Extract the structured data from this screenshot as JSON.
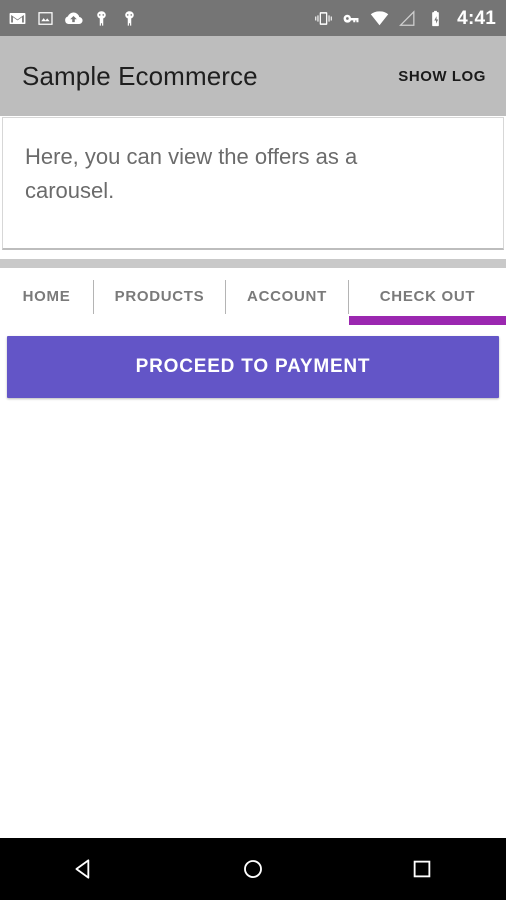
{
  "status_bar": {
    "background": "#757575",
    "clock": "4:41",
    "left_icons": [
      {
        "name": "gmail-icon",
        "label": "Gmail"
      },
      {
        "name": "image-icon",
        "label": "Photos"
      },
      {
        "name": "cloud-upload-icon",
        "label": "Cloud upload"
      },
      {
        "name": "android-debug-icon",
        "label": "Android"
      },
      {
        "name": "android-debug-icon-2",
        "label": "Android"
      }
    ],
    "right_icons": [
      {
        "name": "vibrate-icon",
        "label": "Vibrate"
      },
      {
        "name": "vpn-key-icon",
        "label": "VPN key"
      },
      {
        "name": "wifi-icon",
        "label": "Wi-Fi"
      },
      {
        "name": "signal-icon",
        "label": "No signal"
      },
      {
        "name": "battery-charging-icon",
        "label": "Battery charging"
      }
    ]
  },
  "app_bar": {
    "background": "#bdbdbd",
    "title": "Sample Ecommerce",
    "action_label": "SHOW LOG"
  },
  "card": {
    "text": "Here, you can view the offers as a carousel."
  },
  "tabs": {
    "selected_index": 3,
    "indicator_color": "#9b27b0",
    "items": [
      {
        "label": "HOME",
        "name": "tab-home"
      },
      {
        "label": "PRODUCTS",
        "name": "tab-products"
      },
      {
        "label": "ACCOUNT",
        "name": "tab-account"
      },
      {
        "label": "CHECK OUT",
        "name": "tab-checkout"
      }
    ]
  },
  "content": {
    "primary_button_label": "PROCEED TO PAYMENT",
    "primary_button_color": "#6355c7"
  },
  "nav_bar": {
    "background": "#000000",
    "buttons": [
      {
        "name": "nav-back-button",
        "label": "Back"
      },
      {
        "name": "nav-home-button",
        "label": "Home"
      },
      {
        "name": "nav-recents-button",
        "label": "Recents"
      }
    ]
  }
}
